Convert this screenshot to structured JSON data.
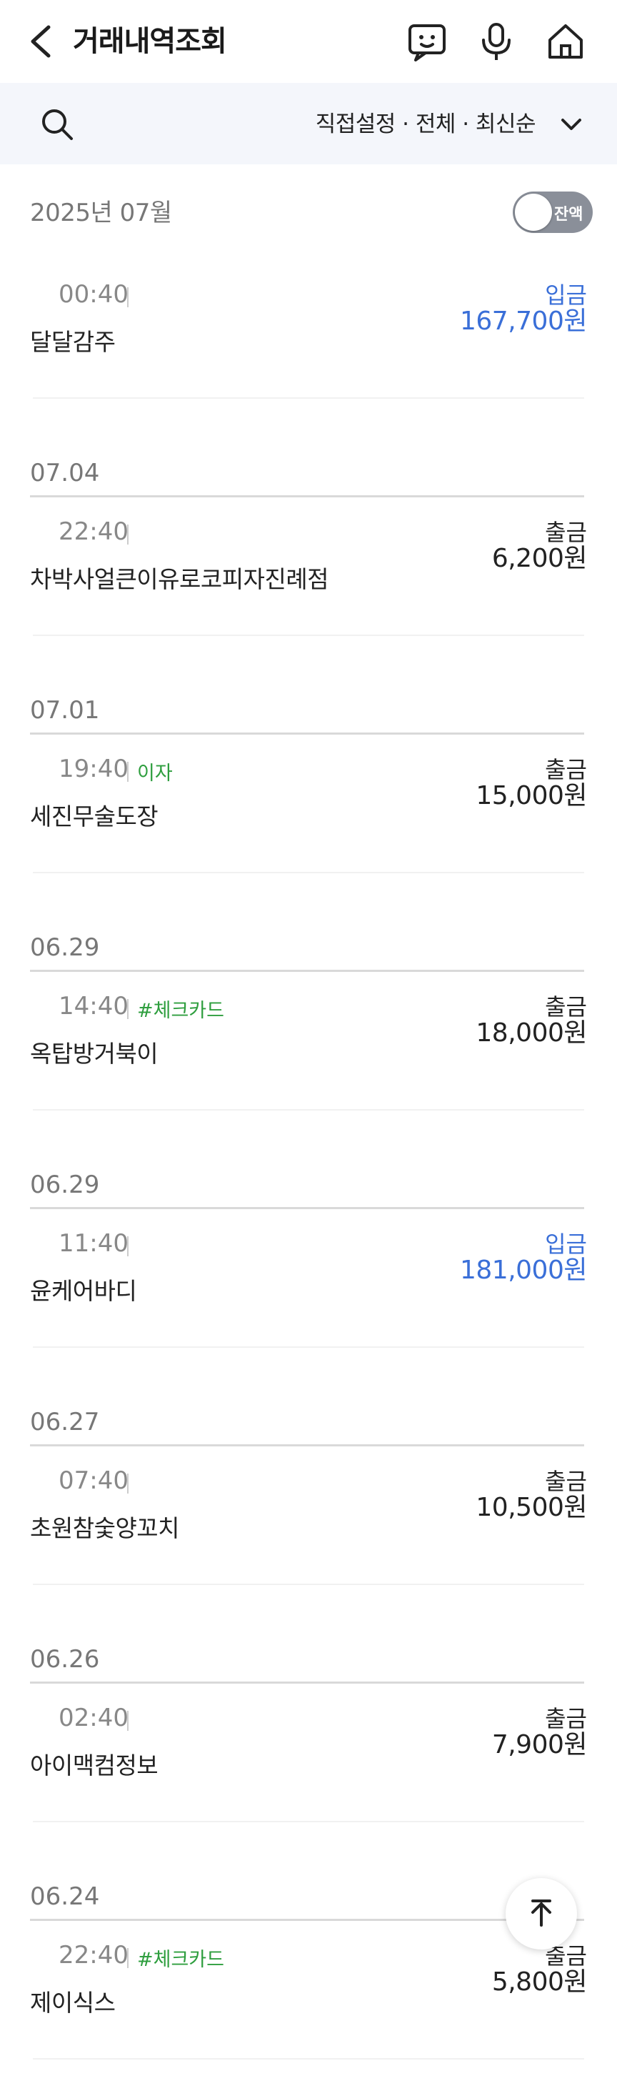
{
  "header": {
    "title": "거래내역조회",
    "icons": [
      "back-arrow-icon",
      "chat-bot-icon",
      "microphone-icon",
      "home-icon"
    ]
  },
  "filter": {
    "summary": "직접설정 · 전체 · 최신순",
    "icons": [
      "search-icon",
      "chevron-down-icon"
    ]
  },
  "month": {
    "label": "2025년 07월",
    "balance_toggle_label": "잔액",
    "balance_toggle_on": false
  },
  "colors": {
    "deposit": "#3a6fd8",
    "tag": "#2e9e3e",
    "filter_bg": "#f4f6fb"
  },
  "groups": [
    {
      "date": "",
      "transactions": [
        {
          "time": "00:40",
          "tag": "",
          "merchant": "달달감주",
          "type": "입금",
          "amount": "167,700원",
          "direction": "in"
        }
      ]
    },
    {
      "date": "07.04",
      "transactions": [
        {
          "time": "22:40",
          "tag": "",
          "merchant": "차박사얼큰이유로코피자진례점",
          "type": "출금",
          "amount": "6,200원",
          "direction": "out"
        }
      ]
    },
    {
      "date": "07.01",
      "transactions": [
        {
          "time": "19:40",
          "tag": "이자",
          "merchant": "세진무술도장",
          "type": "출금",
          "amount": "15,000원",
          "direction": "out"
        }
      ]
    },
    {
      "date": "06.29",
      "transactions": [
        {
          "time": "14:40",
          "tag": "#체크카드",
          "merchant": "옥탑방거북이",
          "type": "출금",
          "amount": "18,000원",
          "direction": "out"
        }
      ]
    },
    {
      "date": "06.29",
      "transactions": [
        {
          "time": "11:40",
          "tag": "",
          "merchant": "윤케어바디",
          "type": "입금",
          "amount": "181,000원",
          "direction": "in"
        }
      ]
    },
    {
      "date": "06.27",
      "transactions": [
        {
          "time": "07:40",
          "tag": "",
          "merchant": "초원참숯양꼬치",
          "type": "출금",
          "amount": "10,500원",
          "direction": "out"
        }
      ]
    },
    {
      "date": "06.26",
      "transactions": [
        {
          "time": "02:40",
          "tag": "",
          "merchant": "아이맥컴정보",
          "type": "출금",
          "amount": "7,900원",
          "direction": "out"
        }
      ]
    },
    {
      "date": "06.24",
      "transactions": [
        {
          "time": "22:40",
          "tag": "#체크카드",
          "merchant": "제이식스",
          "type": "출금",
          "amount": "5,800원",
          "direction": "out"
        }
      ]
    }
  ],
  "scroll_top_button": "arrow-up-icon"
}
